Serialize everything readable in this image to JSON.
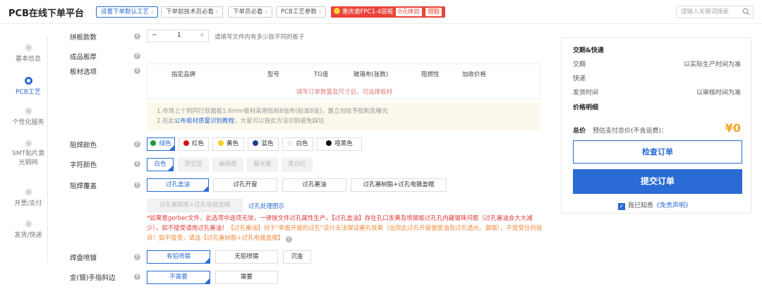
{
  "header": {
    "brand": "PCB在线下单平台",
    "crumbs": [
      {
        "label": "设置下单默认工艺"
      },
      {
        "label": "下单前技术员必看"
      },
      {
        "label": "下单员必看"
      },
      {
        "label": "PCB工艺参数"
      }
    ],
    "promo": {
      "label": "重庆邀FPC1-4层板",
      "free": "0元体验",
      "get": "领取"
    },
    "search_placeholder": "请输入关键词搜索"
  },
  "sidebar": {
    "items": [
      {
        "label": "基本信息"
      },
      {
        "label": "PCB工艺"
      },
      {
        "label": "个性化服务"
      },
      {
        "label": "SMT贴片激光钢网"
      },
      {
        "label": "开票/支付"
      },
      {
        "label": "发货/快递"
      }
    ],
    "active_index": 1
  },
  "form": {
    "panel_count": {
      "label": "拼板款数",
      "value": "1",
      "minus": "−",
      "plus": "+",
      "hint": "请填写文件内有多少款不同的板子"
    },
    "finished_thickness": {
      "label": "成品板厚"
    },
    "material": {
      "label": "板材选项",
      "columns": [
        "指定品牌",
        "型号",
        "TG值",
        "玻璃布(张数)",
        "阻燃性",
        "加收价格"
      ],
      "empty_text": "填写订单数量及尺寸后，可选择板材"
    },
    "notes": {
      "line1": "1.市场上个别同行双面板1.6mm板材采用低档8张布(标准8张)，嘉立创给予抵制及曝光",
      "line2_prefix": "2.在此",
      "line2_link": "公布板材质量识别教程",
      "line2_suffix": "，大家可以按此方法识别避免踩坑"
    },
    "solder_mask": {
      "label": "阻焊颜色",
      "options": [
        {
          "label": "绿色",
          "color": "#1a9a3a"
        },
        {
          "label": "红色",
          "color": "#d8101e"
        },
        {
          "label": "黄色",
          "color": "#f5d21c"
        },
        {
          "label": "蓝色",
          "color": "#1f3f8f"
        },
        {
          "label": "白色",
          "color": "#eeeeee"
        },
        {
          "label": "哑黑色",
          "color": "#111111"
        }
      ],
      "selected": "绿色"
    },
    "silkscreen": {
      "label": "字符颜色",
      "options": [
        "白色",
        "深空蓝",
        "幽暗橙",
        "暮光紫",
        "黑白红"
      ],
      "selected": "白色"
    },
    "via_cover": {
      "label": "阻焊覆盖",
      "options": [
        "过孔盖油",
        "过孔开窗",
        "过孔塞油",
        "过孔塞树脂+过孔电镀盖帽"
      ],
      "disabled_option": "过孔塞铜浆+过孔电镀盖帽",
      "link": "过孔处理图示",
      "selected": "过孔盖油"
    },
    "warning": {
      "red1": "*如果是gerber文件，此选项中选项无效，一律按文件过孔属性生产。【过孔盖油】存在孔口发黄及喷锡板过孔孔内藏锡珠问题（过孔塞油会大大减少），如不接受请用过孔塞油！",
      "orange": "【过孔塞油】对于\"单面开窗的过孔\"设计无法保证塞孔效果（出现此过孔开窗面冒油及过孔透光、漏锡），不接受任何投诉！如不接受，请选【过孔塞树脂+过孔电镀盖帽】",
      "q": "?"
    },
    "surface_finish": {
      "label": "焊盘喷镀",
      "options": [
        "有铅喷锡",
        "无铅喷锡",
        "沉金"
      ],
      "selected": "有铅喷锡"
    },
    "gold_finger": {
      "label": "金(锡)手指斜边",
      "options": [
        "不需要",
        "需要"
      ],
      "selected": "不需要"
    },
    "help_q": "?"
  },
  "summary": {
    "delivery_title": "交期&快递",
    "delivery_label": "交期",
    "delivery_value": "以实际生产时间为准",
    "express_label": "快递",
    "ship_label": "发货时间",
    "ship_value": "以审核时间为准",
    "price_title": "价格明细",
    "total_label": "总价",
    "total_hint": "预估支付总价(不含运费)：",
    "total_value": "¥0",
    "check_button": "检查订单",
    "submit_button": "提交订单",
    "agree_prefix": "我已知悉",
    "agree_link": "《免责声明》"
  },
  "colors": {
    "accent": "#2b6bd6",
    "danger": "#e23a3a",
    "price": "#f5a623"
  }
}
